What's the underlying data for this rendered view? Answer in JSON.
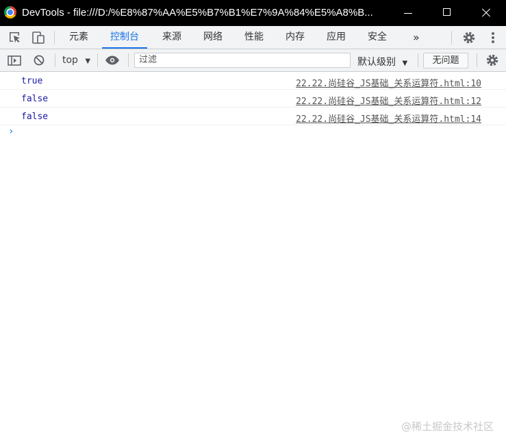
{
  "window": {
    "title": "DevTools - file:///D:/%E8%87%AA%E5%B7%B1%E7%9A%84%E5%A8%B..."
  },
  "tabs": [
    {
      "label": "元素"
    },
    {
      "label": "控制台",
      "active": true
    },
    {
      "label": "来源"
    },
    {
      "label": "网络"
    },
    {
      "label": "性能"
    },
    {
      "label": "内存"
    },
    {
      "label": "应用"
    },
    {
      "label": "安全"
    }
  ],
  "tabbar": {
    "more": "»"
  },
  "toolbar": {
    "context": "top",
    "filter_placeholder": "过滤",
    "levels": "默认级别",
    "issues": "无问题"
  },
  "console": {
    "rows": [
      {
        "value": "true",
        "source": "22.22.尚硅谷_JS基础_关系运算符.html:10"
      },
      {
        "value": "false",
        "source": "22.22.尚硅谷_JS基础_关系运算符.html:12"
      },
      {
        "value": "false",
        "source": "22.22.尚硅谷_JS基础_关系运算符.html:14"
      }
    ],
    "prompt": "›"
  },
  "watermark": "@稀土掘金技术社区",
  "colors": {
    "accent": "#1a73e8",
    "value": "#1a1aa6"
  },
  "icons": [
    "chrome-icon",
    "inspect-icon",
    "device-icon",
    "gear-icon",
    "kebab-icon",
    "sidebar-icon",
    "clear-icon",
    "eye-icon"
  ]
}
